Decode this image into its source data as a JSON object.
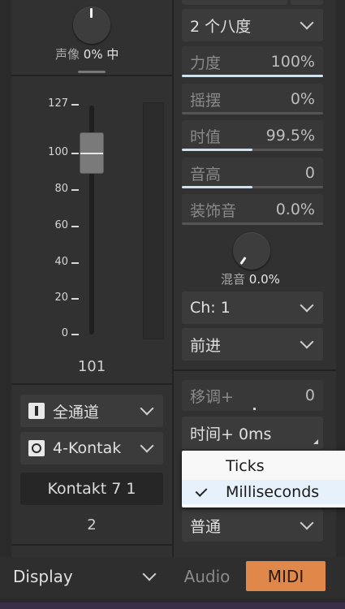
{
  "pan": {
    "label": "声像",
    "value": "0%",
    "position": "中"
  },
  "fader": {
    "ticks": [
      "127",
      "100",
      "80",
      "60",
      "40",
      "20",
      "0"
    ],
    "level": "101",
    "level_fraction": 0.79
  },
  "channel_select": {
    "value": "全通道"
  },
  "port_select": {
    "value": "4-Kontak"
  },
  "instrument": {
    "name": "Kontakt 7 1",
    "channel_number": "2"
  },
  "octave_select": {
    "value": "2 个八度"
  },
  "params": [
    {
      "name": "力度",
      "value": "100%",
      "fill": 1.0
    },
    {
      "name": "摇摆",
      "value": "0%",
      "fill": 0.0
    },
    {
      "name": "时值",
      "value": "99.5%",
      "fill": 0.5
    },
    {
      "name": "音高",
      "value": "0",
      "fill": 0.5
    },
    {
      "name": "装饰音",
      "value": "0.0%",
      "fill": 0.0
    }
  ],
  "mix": {
    "label": "混音",
    "value": "0.0%"
  },
  "midi_channel_select": {
    "value": "Ch: 1"
  },
  "direction_select": {
    "value": "前进"
  },
  "transpose": {
    "name": "移调+",
    "value": "0"
  },
  "time_offset": {
    "label": "时间+ 0ms"
  },
  "time_menu": {
    "items": [
      "Ticks",
      "Milliseconds"
    ],
    "selected": "Milliseconds"
  },
  "mode_select": {
    "value": "普通"
  },
  "bottom": {
    "display_label": "Display",
    "audio_tab": "Audio",
    "midi_tab": "MIDI"
  },
  "colors": {
    "midi_active": "#e0884a",
    "accent_bar": "#cfe2ec"
  }
}
